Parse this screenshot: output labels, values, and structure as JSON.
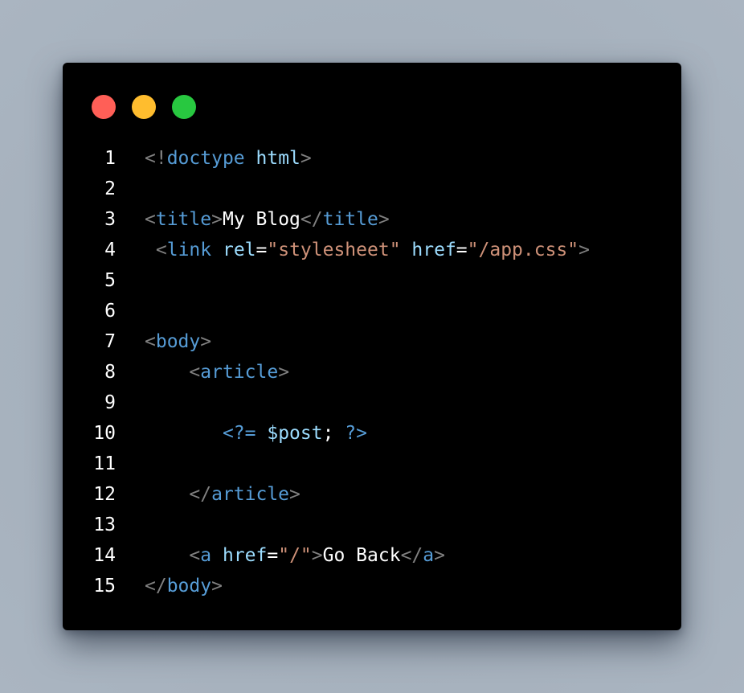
{
  "window": {
    "buttons": [
      {
        "name": "close",
        "color": "#ff5f57"
      },
      {
        "name": "minimize",
        "color": "#ffbd2e"
      },
      {
        "name": "maximize",
        "color": "#28c840"
      }
    ]
  },
  "colors": {
    "punctuation": "#808080",
    "tag": "#569cd6",
    "attribute": "#9cdcfe",
    "string": "#ce9178",
    "text": "#ffffff",
    "background": "#000000"
  },
  "lines": [
    {
      "number": "1",
      "tokens": [
        {
          "text": "<!",
          "type": "punctuation"
        },
        {
          "text": "doctype",
          "type": "tag"
        },
        {
          "text": " ",
          "type": "text"
        },
        {
          "text": "html",
          "type": "attribute"
        },
        {
          "text": ">",
          "type": "punctuation"
        }
      ]
    },
    {
      "number": "2",
      "tokens": []
    },
    {
      "number": "3",
      "tokens": [
        {
          "text": "<",
          "type": "punctuation"
        },
        {
          "text": "title",
          "type": "tag"
        },
        {
          "text": ">",
          "type": "punctuation"
        },
        {
          "text": "My Blog",
          "type": "text"
        },
        {
          "text": "</",
          "type": "punctuation"
        },
        {
          "text": "title",
          "type": "tag"
        },
        {
          "text": ">",
          "type": "punctuation"
        }
      ]
    },
    {
      "number": "4",
      "tokens": [
        {
          "text": " ",
          "type": "text"
        },
        {
          "text": "<",
          "type": "punctuation"
        },
        {
          "text": "link",
          "type": "tag"
        },
        {
          "text": " ",
          "type": "text"
        },
        {
          "text": "rel",
          "type": "attribute"
        },
        {
          "text": "=",
          "type": "text"
        },
        {
          "text": "\"stylesheet\"",
          "type": "string"
        },
        {
          "text": " ",
          "type": "text"
        },
        {
          "text": "href",
          "type": "attribute"
        },
        {
          "text": "=",
          "type": "text"
        },
        {
          "text": "\"/app.css\"",
          "type": "string"
        },
        {
          "text": ">",
          "type": "punctuation"
        }
      ]
    },
    {
      "number": "5",
      "tokens": []
    },
    {
      "number": "6",
      "tokens": []
    },
    {
      "number": "7",
      "tokens": [
        {
          "text": "<",
          "type": "punctuation"
        },
        {
          "text": "body",
          "type": "tag"
        },
        {
          "text": ">",
          "type": "punctuation"
        }
      ]
    },
    {
      "number": "8",
      "tokens": [
        {
          "text": "    ",
          "type": "text"
        },
        {
          "text": "<",
          "type": "punctuation"
        },
        {
          "text": "article",
          "type": "tag"
        },
        {
          "text": ">",
          "type": "punctuation"
        }
      ]
    },
    {
      "number": "9",
      "tokens": []
    },
    {
      "number": "10",
      "tokens": [
        {
          "text": "       ",
          "type": "text"
        },
        {
          "text": "<?=",
          "type": "tag"
        },
        {
          "text": " ",
          "type": "text"
        },
        {
          "text": "$post",
          "type": "attribute"
        },
        {
          "text": "; ",
          "type": "text"
        },
        {
          "text": "?>",
          "type": "tag"
        }
      ]
    },
    {
      "number": "11",
      "tokens": []
    },
    {
      "number": "12",
      "tokens": [
        {
          "text": "    ",
          "type": "text"
        },
        {
          "text": "</",
          "type": "punctuation"
        },
        {
          "text": "article",
          "type": "tag"
        },
        {
          "text": ">",
          "type": "punctuation"
        }
      ]
    },
    {
      "number": "13",
      "tokens": []
    },
    {
      "number": "14",
      "tokens": [
        {
          "text": "    ",
          "type": "text"
        },
        {
          "text": "<",
          "type": "punctuation"
        },
        {
          "text": "a",
          "type": "tag"
        },
        {
          "text": " ",
          "type": "text"
        },
        {
          "text": "href",
          "type": "attribute"
        },
        {
          "text": "=",
          "type": "text"
        },
        {
          "text": "\"/\"",
          "type": "string"
        },
        {
          "text": ">",
          "type": "punctuation"
        },
        {
          "text": "Go Back",
          "type": "text"
        },
        {
          "text": "</",
          "type": "punctuation"
        },
        {
          "text": "a",
          "type": "tag"
        },
        {
          "text": ">",
          "type": "punctuation"
        }
      ]
    },
    {
      "number": "15",
      "tokens": [
        {
          "text": "</",
          "type": "punctuation"
        },
        {
          "text": "body",
          "type": "tag"
        },
        {
          "text": ">",
          "type": "punctuation"
        }
      ]
    }
  ]
}
